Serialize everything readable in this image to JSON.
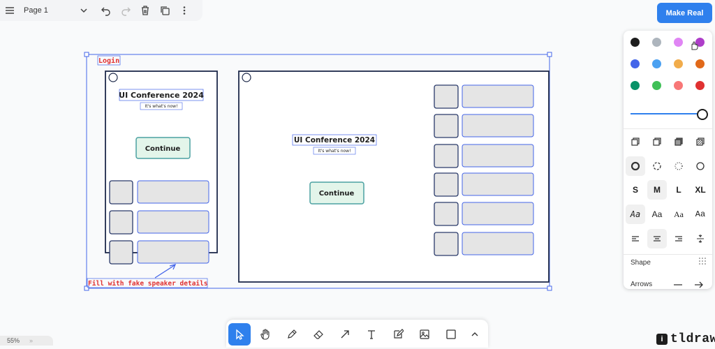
{
  "menu": {
    "icon": "hamburger-icon",
    "page_name": "Page 1",
    "page_chevron_icon": "chevron-down-icon",
    "undo_icon": "undo-icon",
    "redo_icon": "redo-icon",
    "delete_icon": "trash-icon",
    "duplicate_icon": "duplicate-icon",
    "more_icon": "more-vertical-icon"
  },
  "make_real": {
    "label": "Make Real",
    "color": "#2f80ed"
  },
  "canvas": {
    "annotation_login": "Login",
    "annotation_fill": "Fill with fake speaker details",
    "annotation_color": "#e03131",
    "mobile": {
      "title": "UI Conference 2024",
      "subtitle": "It's what's now!",
      "button": "Continue"
    },
    "desktop": {
      "title": "UI Conference 2024",
      "subtitle": "It's what's now!",
      "button": "Continue"
    },
    "selection_color": "#4465e9",
    "button_fill": "#e3f5ea",
    "button_border": "#4ba1a1"
  },
  "style_panel": {
    "colors": [
      "#1d1d1d",
      "#adb5bd",
      "#e085f4",
      "#ae3ec9",
      "#4465e9",
      "#4ba1f1",
      "#f1ac4b",
      "#e16919",
      "#099268",
      "#40c057",
      "#f87777",
      "#e03131"
    ],
    "selected_color": "#ae3ec9",
    "opacity": 1,
    "fill_icons": [
      "fill-none-icon",
      "fill-semi-icon",
      "fill-solid-icon",
      "fill-pattern-icon"
    ],
    "dash_icons": [
      "dash-draw-icon",
      "dash-dashed-icon",
      "dash-dotted-icon",
      "dash-solid-icon"
    ],
    "sizes": [
      "S",
      "M",
      "L",
      "XL"
    ],
    "selected_size": "M",
    "fonts": [
      "Aa",
      "Aa",
      "Aa",
      "Aa"
    ],
    "align_icons": [
      "align-left-icon",
      "align-center-icon",
      "align-right-icon",
      "align-vertical-icon"
    ],
    "shape_label": "Shape",
    "arrows_label": "Arrows"
  },
  "toolbar": {
    "tools": [
      "select-icon",
      "hand-icon",
      "draw-icon",
      "eraser-icon",
      "arrow-icon",
      "text-icon",
      "note-icon",
      "image-icon",
      "rectangle-icon",
      "chevron-up-icon"
    ],
    "active": "select-icon"
  },
  "zoom": {
    "level": "55%",
    "arrows": "»"
  },
  "brand": {
    "name": "tldraw",
    "mark": "i"
  }
}
